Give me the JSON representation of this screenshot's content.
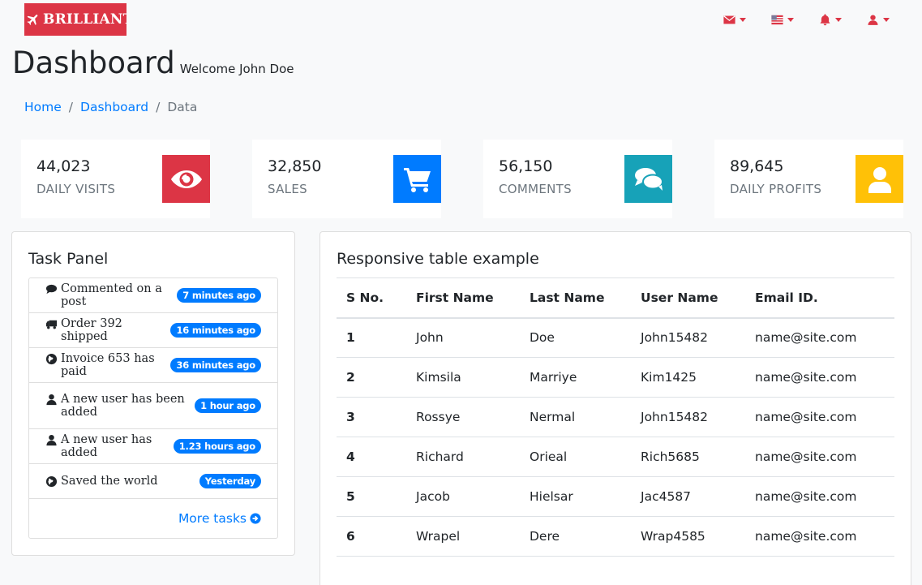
{
  "brand": {
    "name": "BRILLIANT",
    "icon": "plane-icon",
    "color": "#dc3545"
  },
  "top_nav": [
    {
      "icon": "envelope-icon"
    },
    {
      "icon": "flag-icon"
    },
    {
      "icon": "bell-icon"
    },
    {
      "icon": "user-icon"
    }
  ],
  "header": {
    "title": "Dashboard",
    "subtitle": "Welcome John Doe"
  },
  "breadcrumb": {
    "home": "Home",
    "dashboard": "Dashboard",
    "current": "Data"
  },
  "stats": [
    {
      "value": "44,023",
      "label": "DAILY VISITS",
      "icon": "eye-icon",
      "color": "#dc3545"
    },
    {
      "value": "32,850",
      "label": "SALES",
      "icon": "cart-icon",
      "color": "#007bff"
    },
    {
      "value": "56,150",
      "label": "COMMENTS",
      "icon": "comments-icon",
      "color": "#17a2b8"
    },
    {
      "value": "89,645",
      "label": "DAILY PROFITS",
      "icon": "user-icon",
      "color": "#ffc107"
    }
  ],
  "task_panel": {
    "title": "Task Panel",
    "items": [
      {
        "icon": "comment-icon",
        "text": "Commented on a post",
        "time": "7 minutes ago"
      },
      {
        "icon": "truck-icon",
        "text": "Order 392 shipped",
        "time": "16 minutes ago"
      },
      {
        "icon": "globe-icon",
        "text": "Invoice 653 has paid",
        "time": "36 minutes ago"
      },
      {
        "icon": "user-icon",
        "text": "A new user has been added",
        "time": "1 hour ago"
      },
      {
        "icon": "user-icon",
        "text": "A new user has added",
        "time": "1.23 hours ago"
      },
      {
        "icon": "globe-icon",
        "text": "Saved the world",
        "time": "Yesterday"
      }
    ],
    "more_label": "More tasks"
  },
  "table_panel": {
    "title": "Responsive table example",
    "columns": [
      "S No.",
      "First Name",
      "Last Name",
      "User Name",
      "Email ID."
    ],
    "rows": [
      [
        "1",
        "John",
        "Doe",
        "John15482",
        "name@site.com"
      ],
      [
        "2",
        "Kimsila",
        "Marriye",
        "Kim1425",
        "name@site.com"
      ],
      [
        "3",
        "Rossye",
        "Nermal",
        "John15482",
        "name@site.com"
      ],
      [
        "4",
        "Richard",
        "Orieal",
        "Rich5685",
        "name@site.com"
      ],
      [
        "5",
        "Jacob",
        "Hielsar",
        "Jac4587",
        "name@site.com"
      ],
      [
        "6",
        "Wrapel",
        "Dere",
        "Wrap4585",
        "name@site.com"
      ]
    ]
  }
}
